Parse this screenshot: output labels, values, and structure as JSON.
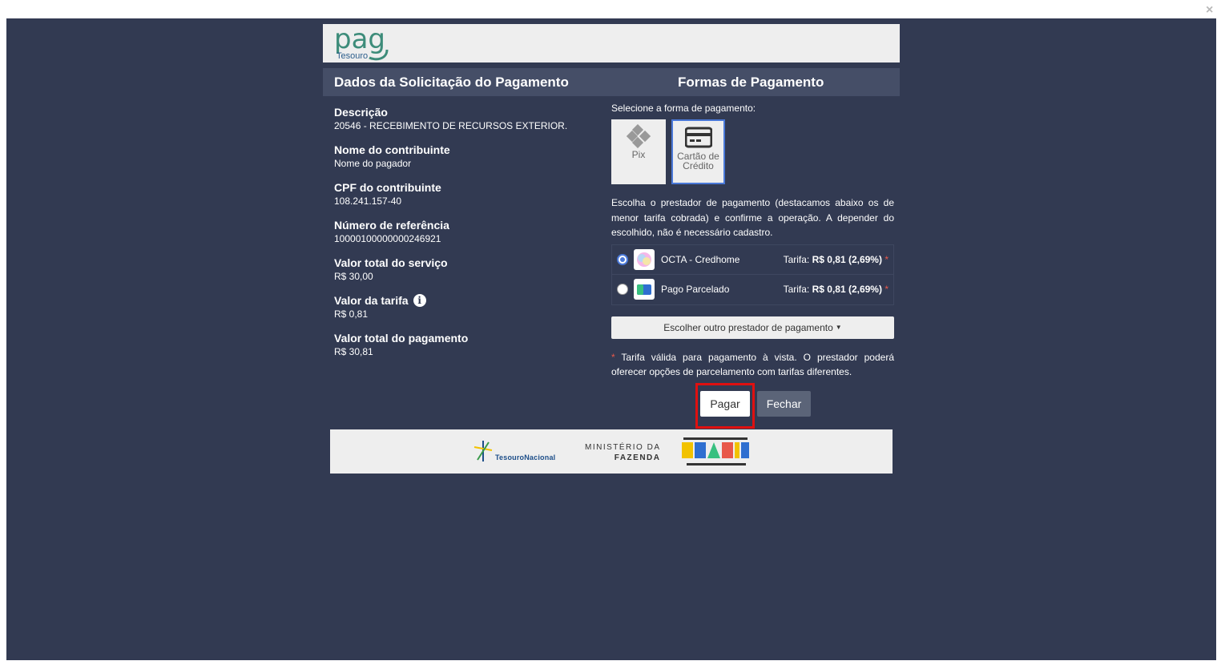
{
  "window": {
    "close_glyph": "×"
  },
  "logo": {
    "brand": "pag",
    "sub": "Tesouro"
  },
  "headers": {
    "left": "Dados da Solicitação do Pagamento",
    "right": "Formas de Pagamento"
  },
  "fields": [
    {
      "label": "Descrição",
      "value": "20546 - RECEBIMENTO DE RECURSOS EXTERIOR."
    },
    {
      "label": "Nome do contribuinte",
      "value": "Nome do pagador"
    },
    {
      "label": "CPF do contribuinte",
      "value": "108.241.157-40"
    },
    {
      "label": "Número de referência",
      "value": "10000100000000246921"
    },
    {
      "label": "Valor total do serviço",
      "value": "R$  30,00"
    },
    {
      "label": "Valor da tarifa",
      "value": "R$  0,81"
    },
    {
      "label": "Valor total do pagamento",
      "value": "R$  30,81"
    }
  ],
  "payment": {
    "select_label": "Selecione a forma de pagamento:",
    "methods": [
      {
        "label": "Pix",
        "icon": "pix-icon",
        "selected": false
      },
      {
        "label": "Cartão de Crédito",
        "icon": "credit-card-icon",
        "selected": true
      }
    ],
    "description": "Escolha o prestador de pagamento (destacamos abaixo os de menor tarifa cobrada) e confirme a operação. A depender do escolhido, não é necessário cadastro.",
    "providers": [
      {
        "name": "OCTA - Credhome",
        "tarifa_label": "Tarifa:",
        "tarifa_value": "R$  0,81 (2,69%)",
        "asterisk": "*",
        "selected": true
      },
      {
        "name": "Pago Parcelado",
        "tarifa_label": "Tarifa:",
        "tarifa_value": "R$  0,81 (2,69%)",
        "asterisk": "*",
        "selected": false
      }
    ],
    "other_provider": "Escolher outro prestador de pagamento",
    "note_asterisk": "*",
    "note": " Tarifa válida para pagamento à vista. O prestador poderá oferecer opções de parcelamento com tarifas diferentes."
  },
  "actions": {
    "pay": "Pagar",
    "close": "Fechar"
  },
  "footer": {
    "tesouro": "TesouroNacional",
    "ministerio_line1": "MINISTÉRIO DA",
    "ministerio_line2": "FAZENDA"
  },
  "colors": {
    "overlay": "#323a52",
    "header": "#454e67",
    "accent": "#4a78d8",
    "highlight": "#e01010"
  }
}
